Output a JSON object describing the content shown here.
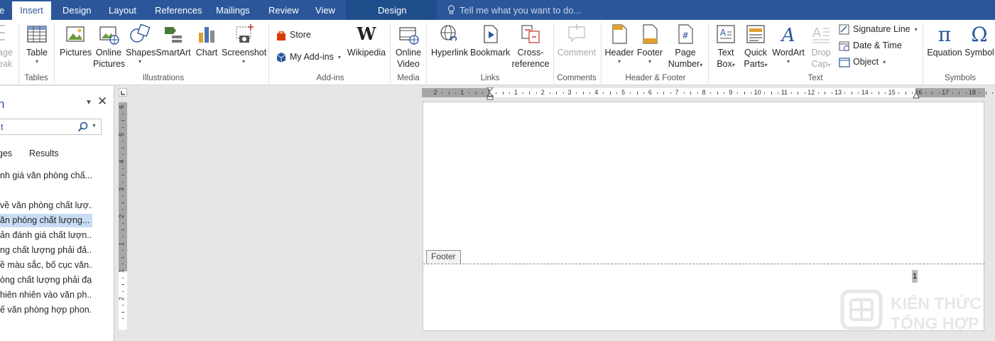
{
  "tabs": [
    {
      "label": "e"
    },
    {
      "label": "Insert"
    },
    {
      "label": "Design"
    },
    {
      "label": "Layout"
    },
    {
      "label": "References"
    },
    {
      "label": "Mailings"
    },
    {
      "label": "Review"
    },
    {
      "label": "View"
    },
    {
      "label": "Design"
    }
  ],
  "tell_me": "Tell me what you want to do...",
  "ribbon": {
    "pages_partial": {
      "line1": "age",
      "line2": "eak"
    },
    "tables": {
      "table": "Table",
      "group": "Tables"
    },
    "illustrations": {
      "pictures": "Pictures",
      "online_pictures_1": "Online",
      "online_pictures_2": "Pictures",
      "shapes": "Shapes",
      "smartart": "SmartArt",
      "chart": "Chart",
      "screenshot": "Screenshot",
      "group": "Illustrations"
    },
    "addins": {
      "store": "Store",
      "my_addins": "My Add-ins",
      "wikipedia": "Wikipedia",
      "group": "Add-ins"
    },
    "media": {
      "online_video_1": "Online",
      "online_video_2": "Video",
      "group": "Media"
    },
    "links": {
      "hyperlink": "Hyperlink",
      "bookmark": "Bookmark",
      "cross_1": "Cross-",
      "cross_2": "reference",
      "group": "Links"
    },
    "comments": {
      "comment": "Comment",
      "group": "Comments"
    },
    "header_footer": {
      "header": "Header",
      "footer": "Footer",
      "page_number_1": "Page",
      "page_number_2": "Number",
      "group": "Header & Footer"
    },
    "text": {
      "text_box_1": "Text",
      "text_box_2": "Box",
      "quick_parts_1": "Quick",
      "quick_parts_2": "Parts",
      "wordart": "WordArt",
      "drop_cap_1": "Drop",
      "drop_cap_2": "Cap",
      "signature_line": "Signature Line",
      "date_time": "Date & Time",
      "object": "Object",
      "group": "Text"
    },
    "symbols": {
      "equation": "Equation",
      "symbol": "Symbol",
      "group": "Symbols"
    }
  },
  "nav_pane": {
    "title": "n",
    "search_value": "t",
    "tabs": [
      "ges",
      "Results"
    ],
    "items": [
      {
        "label": "nh giá văn phòng chấ...",
        "selected": false
      },
      {
        "label": "về văn phòng chất lượ...",
        "selected": false
      },
      {
        "label": "ăn phòng chất lượng...",
        "selected": true
      },
      {
        "label": "ản đánh giá chất lượn...",
        "selected": false
      },
      {
        "label": "ng chất lượng phải đả...",
        "selected": false
      },
      {
        "label": "ề màu sắc, bố cục văn...",
        "selected": false
      },
      {
        "label": "òng chất lượng phải đạ...",
        "selected": false
      },
      {
        "label": "hiên nhiên vào văn ph...",
        "selected": false
      },
      {
        "label": "ế văn phòng hợp phon...",
        "selected": false
      }
    ]
  },
  "hruler_labels": [
    "2",
    "1",
    "1",
    "1",
    "2",
    "3",
    "4",
    "5",
    "6",
    "7",
    "8",
    "9",
    "10",
    "11",
    "12",
    "13",
    "14",
    "15",
    "16",
    "17",
    "18"
  ],
  "vruler_labels": [
    "6",
    "5",
    "4",
    "3",
    "2",
    "1",
    "1",
    "2"
  ],
  "document": {
    "footer_tag": "Footer",
    "page_number": "1"
  },
  "watermark": {
    "line1": "KIẾN THỨC",
    "line2": "TỔNG HỢP"
  },
  "colors": {
    "accent": "#2b579a",
    "selection": "#c7dcf5"
  }
}
